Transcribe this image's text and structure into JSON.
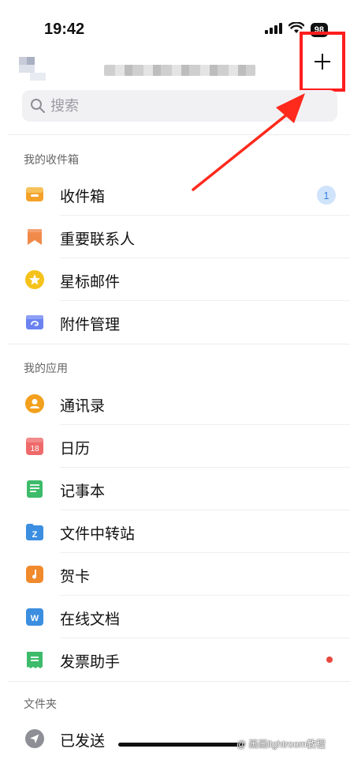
{
  "status_bar": {
    "time": "19:42",
    "battery": "98"
  },
  "search": {
    "placeholder": "搜索"
  },
  "sections": [
    {
      "label": "我的收件箱",
      "items": [
        {
          "label": "收件箱",
          "icon": "inbox-icon",
          "badge": "1"
        },
        {
          "label": "重要联系人",
          "icon": "bookmark-icon"
        },
        {
          "label": "星标邮件",
          "icon": "star-icon"
        },
        {
          "label": "附件管理",
          "icon": "attachment-icon"
        }
      ]
    },
    {
      "label": "我的应用",
      "items": [
        {
          "label": "通讯录",
          "icon": "contacts-icon"
        },
        {
          "label": "日历",
          "icon": "calendar-icon",
          "icon_text": "18"
        },
        {
          "label": "记事本",
          "icon": "notepad-icon"
        },
        {
          "label": "文件中转站",
          "icon": "file-transfer-icon",
          "icon_text": "Z"
        },
        {
          "label": "贺卡",
          "icon": "greeting-card-icon"
        },
        {
          "label": "在线文档",
          "icon": "online-doc-icon",
          "icon_text": "W"
        },
        {
          "label": "发票助手",
          "icon": "invoice-icon",
          "dot": true
        }
      ]
    },
    {
      "label": "文件夹",
      "items": [
        {
          "label": "已发送",
          "icon": "sent-icon"
        }
      ]
    }
  ],
  "watermark": "@ 画画lightroom教程",
  "colors": {
    "highlight": "#ff1e1e",
    "badge_bg": "#cfe3fb",
    "badge_text": "#3a82e6",
    "dot": "#e8493f"
  }
}
